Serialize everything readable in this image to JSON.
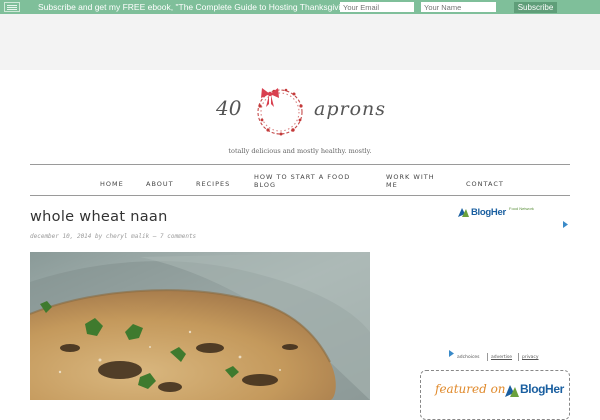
{
  "topbar": {
    "promo_text": "Subscribe and get my FREE ebook, \"The Complete Guide to Hosting Thanksgiving\"!",
    "email_placeholder": "Your Email",
    "name_placeholder": "Your Name",
    "subscribe_label": "Subscribe"
  },
  "logo": {
    "number": "40",
    "word": "aprons",
    "tagline": "totally delicious and mostly healthy.  mostly."
  },
  "nav": {
    "items": [
      "Home",
      "About",
      "Recipes",
      "How to Start a Food Blog",
      "Work With Me",
      "Contact"
    ]
  },
  "post": {
    "title": "whole wheat naan",
    "meta": "december 10, 2014 by cheryl malik — 7 comments"
  },
  "sidebar": {
    "blogher_name": "BlogHer",
    "blogher_sub": "Food Network",
    "ad_links": [
      "adchoices",
      "advertise",
      "privacy"
    ],
    "featured_prefix": "featured on",
    "featured_brand": "BlogHer"
  },
  "colors": {
    "topbar": "#7fbf9a",
    "accent": "#e08a2c",
    "brand_blue": "#1a5fa0"
  }
}
